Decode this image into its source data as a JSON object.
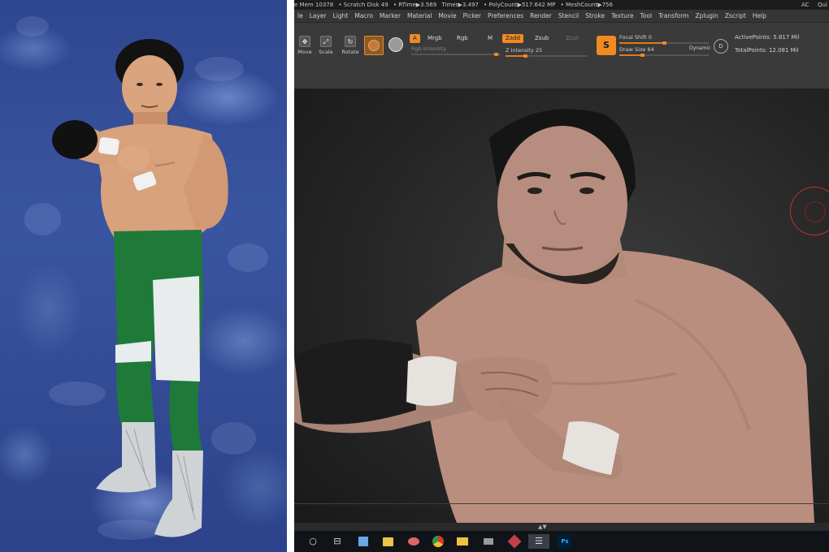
{
  "statusbar": {
    "items": [
      "e Mem 10378",
      "• Scratch Disk 49",
      "• RTime▶3.569",
      "Timer▶3.497",
      "• PolyCount▶517.642 MP",
      "• MeshCount▶756"
    ],
    "right_items": [
      "AC",
      "Qui"
    ]
  },
  "menu": {
    "items": [
      "le",
      "Layer",
      "Light",
      "Macro",
      "Marker",
      "Material",
      "Movie",
      "Picker",
      "Preferences",
      "Render",
      "Stencil",
      "Stroke",
      "Texture",
      "Tool",
      "Transform",
      "Zplugin",
      "Zscript",
      "Help"
    ]
  },
  "toolbar": {
    "move_label": "Move",
    "scale_label": "Scale",
    "rotate_label": "Rotate",
    "a_label": "A",
    "mrgb_label": "Mrgb",
    "rgb_label": "Rgb",
    "m_label": "M",
    "zadd_label": "Zadd",
    "zsub_label": "Zsub",
    "zcut_label": "Zcut",
    "rgb_intensity_label": "Rgb Intensity",
    "z_intensity_label": "Z Intensity",
    "z_intensity_value": "25",
    "focal_shift_label": "Focal Shift",
    "focal_shift_value": "0",
    "draw_size_label": "Draw Size",
    "draw_size_value": "64",
    "dynamic_label": "Dynamic",
    "active_points_label": "ActivePoints:",
    "active_points_value": "5.817 Mil",
    "total_points_label": "TotalPoints:",
    "total_points_value": "12.081 Mil",
    "s_icon_label": "S",
    "d_icon_label": "D"
  },
  "taskbar": {
    "icons": [
      "start-circle-icon",
      "task-view-icon",
      "notes-icon",
      "photos-icon",
      "paint-icon",
      "chrome-icon",
      "folder-icon",
      "app-icon",
      "gem-icon",
      "zbrush-icon",
      "photoshop-icon"
    ],
    "ps_label": "Ps"
  },
  "colors": {
    "accent": "#f08a22",
    "background": "#2b2b2b",
    "photo_backdrop": "#3a55a0"
  }
}
